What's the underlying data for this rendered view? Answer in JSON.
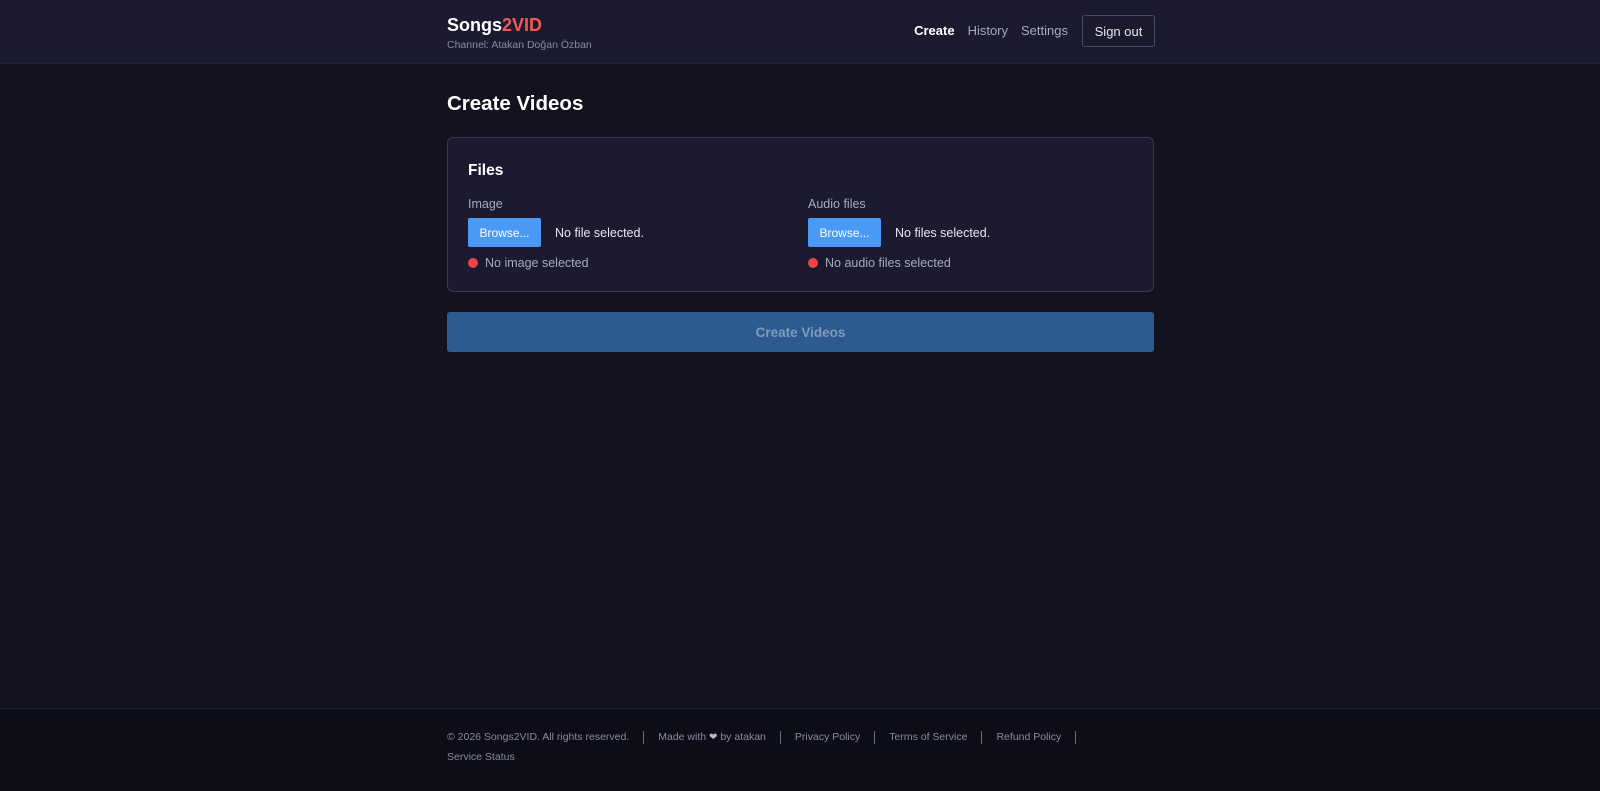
{
  "header": {
    "brand_main": "Songs",
    "brand_accent": "2VID",
    "channel": "Channel: Atakan Doğan Özban",
    "nav": {
      "create": "Create",
      "history": "History",
      "settings": "Settings"
    },
    "signout_label": "Sign out"
  },
  "main": {
    "page_title": "Create Videos",
    "files_card": {
      "title": "Files",
      "image": {
        "label": "Image",
        "browse_label": "Browse...",
        "file_status": "No file selected.",
        "validation": "No image selected"
      },
      "audio": {
        "label": "Audio files",
        "browse_label": "Browse...",
        "file_status": "No files selected.",
        "validation": "No audio files selected"
      }
    },
    "create_button": "Create Videos"
  },
  "footer": {
    "copyright": "© 2026 Songs2VID. All rights reserved.",
    "made_with_prefix": "Made with",
    "heart_glyph": "❤",
    "made_with_suffix": "by atakan",
    "privacy": "Privacy Policy",
    "terms": "Terms of Service",
    "refund": "Refund Policy",
    "status": "Service Status"
  },
  "colors": {
    "background": "#13131f",
    "header_bg": "#1b1a2e",
    "brand_accent": "#f0585c",
    "primary": "#4a9af5",
    "disabled_button": "#2d5a91",
    "error_dot": "#ef4444"
  }
}
